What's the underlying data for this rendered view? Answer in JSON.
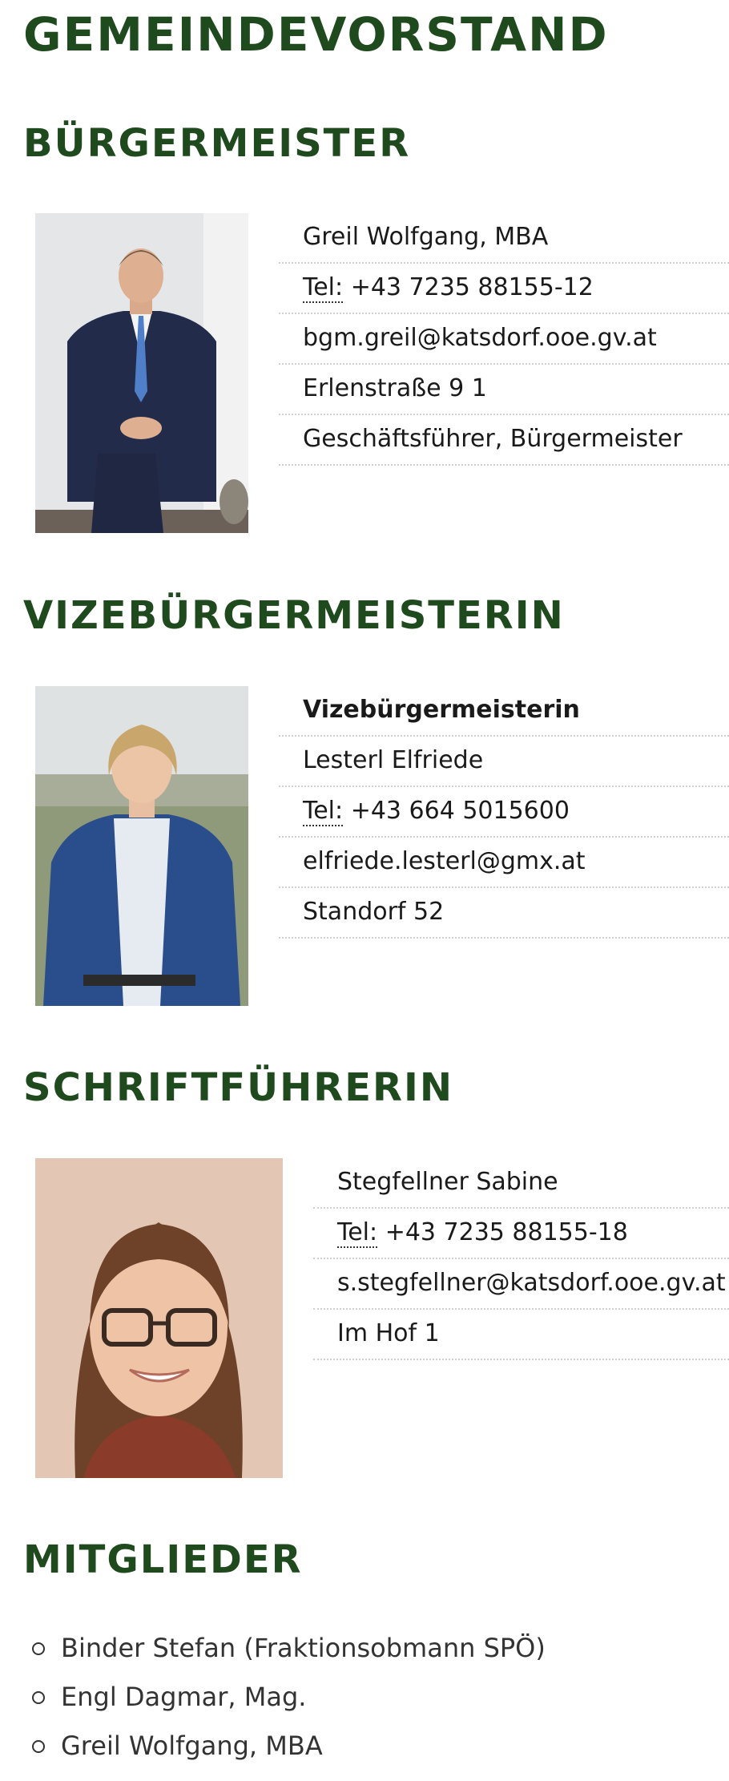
{
  "page": {
    "title": "GEMEINDEVORSTAND"
  },
  "sections": [
    {
      "heading": "BÜRGERMEISTER",
      "photo_alt": "Greil Wolfgang",
      "lines": [
        "Greil Wolfgang, MBA",
        "Tel:",
        "+43 7235 88155-12",
        "bgm.greil@katsdorf.ooe.gv.at",
        "Erlenstraße 9 1",
        "Geschäftsführer, Bürgermeister"
      ]
    },
    {
      "heading": "VIZEBÜRGERMEISTERIN",
      "photo_alt": "Lesterl Elfriede",
      "lines": [
        "Vizebürgermeisterin",
        "Lesterl Elfriede",
        "Tel:",
        "+43 664 5015600",
        "elfriede.lesterl@gmx.at",
        "Standorf 52"
      ]
    },
    {
      "heading": "SCHRIFTFÜHRERIN",
      "photo_alt": "Stegfellner Sabine",
      "lines": [
        "Stegfellner Sabine",
        "Tel:",
        "+43 7235 88155-18",
        "s.stegfellner@katsdorf.ooe.gv.at",
        "Im Hof 1"
      ]
    }
  ],
  "members": {
    "heading": "MITGLIEDER",
    "items": [
      "Binder Stefan (Fraktionsobmann SPÖ)",
      "Engl Dagmar, Mag.",
      "Greil Wolfgang, MBA"
    ]
  },
  "colors": {
    "heading": "#1f4a1d",
    "divider": "#cfcfcf"
  }
}
